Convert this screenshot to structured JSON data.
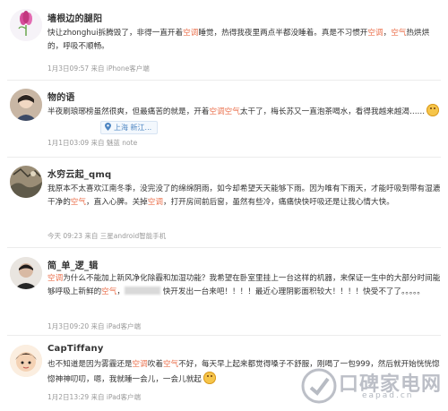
{
  "posts": [
    {
      "user": "墙根边的腿阳",
      "text": [
        {
          "t": "快让zhonghui拆腾毁了，非得一直开着",
          "kw": false
        },
        {
          "t": "空调",
          "kw": true
        },
        {
          "t": "睡觉，热得我夜里两点半都没睡着。真是不习惯开",
          "kw": false
        },
        {
          "t": "空调",
          "kw": true
        },
        {
          "t": "，",
          "kw": false
        },
        {
          "t": "空气",
          "kw": true
        },
        {
          "t": "热烘烘的，呼吸不顺畅。",
          "kw": false
        }
      ],
      "meta": "1月3日09:57 来自 iPhone客户端"
    },
    {
      "user": "物的语",
      "text": [
        {
          "t": "半夜刷琅琊榜虽然很爽，但最痛苦的就是，开着",
          "kw": false
        },
        {
          "t": "空调空气",
          "kw": true
        },
        {
          "t": "太干了，梅长苏又一直泡茶喝水，看得我越来越渴……",
          "kw": false
        }
      ],
      "location": "上海 新江...",
      "meta": "1月1日03:09 来自 魅蓝 note"
    },
    {
      "user": "水穷云起_qmq",
      "text": [
        {
          "t": "我原本不太喜欢江南冬季，没完没了的绵绵阴雨，如今却希望天天能够下雨。因为唯有下雨天，才能吁吸到带有湿漉干净的",
          "kw": false
        },
        {
          "t": "空气",
          "kw": true
        },
        {
          "t": "，直入心脾。关掉",
          "kw": false
        },
        {
          "t": "空调",
          "kw": true
        },
        {
          "t": "，打开房间前后窗，虽然有些冷，痛痛快快吁吸还是让我心情大快。",
          "kw": false
        }
      ],
      "meta": "今天 09:23 来自 三星android智能手机"
    },
    {
      "user": "简_单_逻_辑",
      "text": [
        {
          "t": "空调",
          "kw": true
        },
        {
          "t": "为什么不能加上新风净化除霾和加湿功能？我希望在卧室里挂上一台这样的机器，来保证一生中的大部分时间能够呼吸上新鲜的",
          "kw": false
        },
        {
          "t": "空气",
          "kw": true
        },
        {
          "t": "，",
          "kw": false
        },
        {
          "t": "[blur]",
          "kw": false
        },
        {
          "t": " 快开发出一台来吧！！！！最近心理阴影面积较大！！！！快受不了了。。。。。",
          "kw": false
        }
      ],
      "meta": "1月3日09:20 来自 iPad客户端"
    },
    {
      "user": "CapTiffany",
      "text": [
        {
          "t": "也不知道是因为雾霾还是",
          "kw": false
        },
        {
          "t": "空调",
          "kw": true
        },
        {
          "t": "吹着",
          "kw": false
        },
        {
          "t": "空气",
          "kw": true
        },
        {
          "t": "不好，每天早上起来都觉得嗓子不舒服，刚喝了一包999，然后就开始恍恍惚惚神神叨叨，嗯，我就睡一会儿，一会儿就起",
          "kw": false
        }
      ],
      "meta": "1月2日13:29 来自 iPad客户端"
    }
  ],
  "watermark": {
    "text": "口碑家电网",
    "url": "eapad.cn"
  },
  "colors": {
    "keyword": "#eb7350",
    "meta": "#999999",
    "username": "#333333"
  }
}
